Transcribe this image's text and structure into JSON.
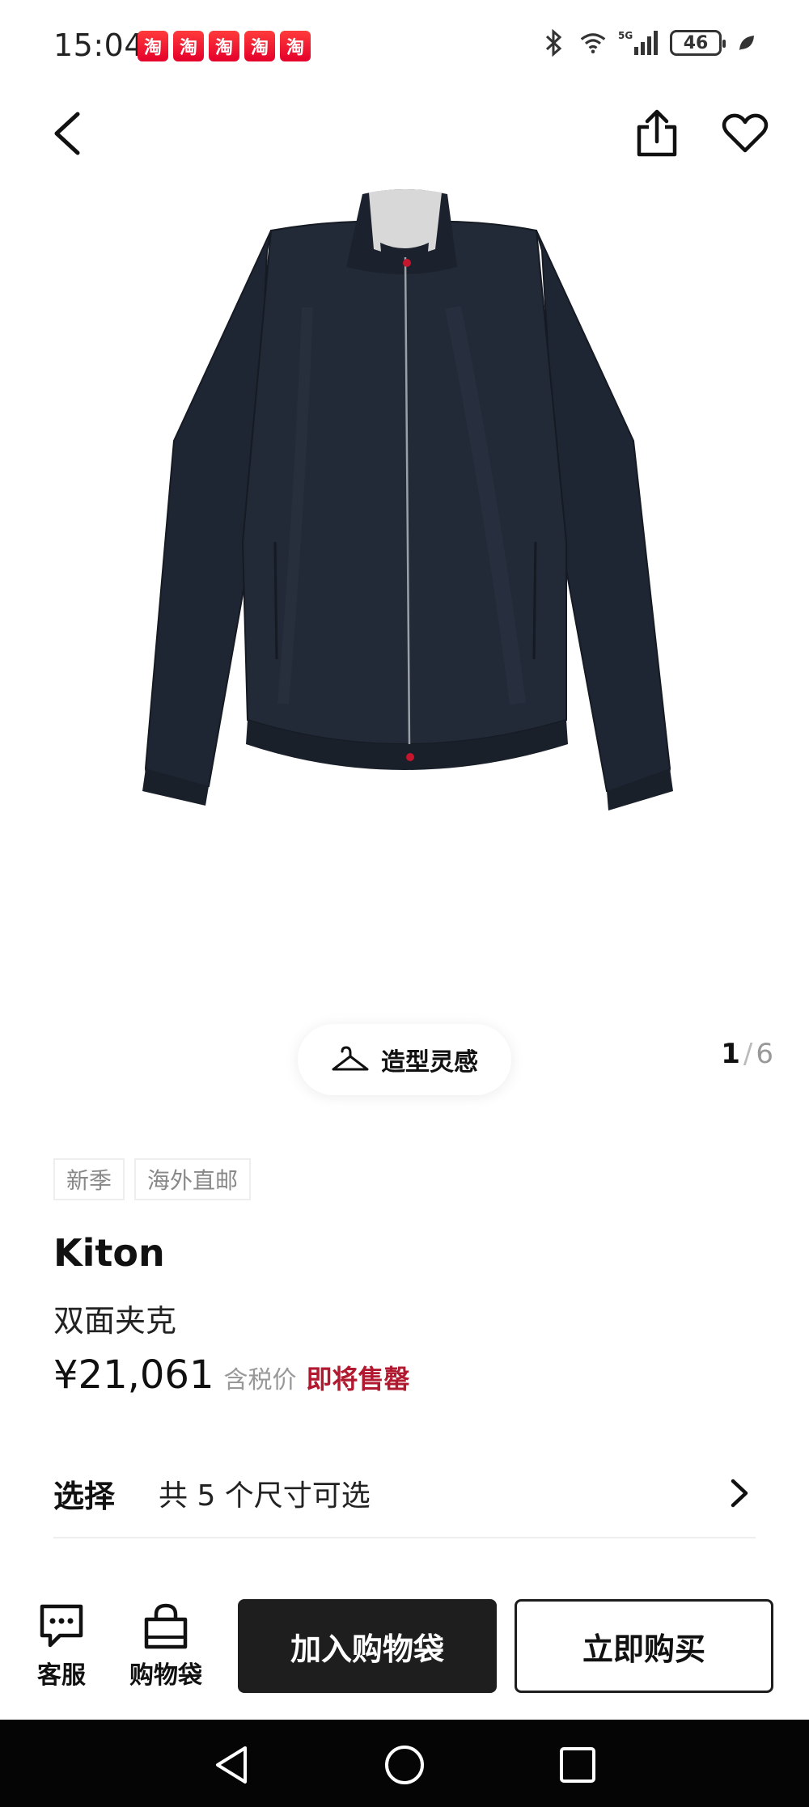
{
  "status_bar": {
    "time": "15:04",
    "app_badge_char": "淘",
    "network": "5G",
    "battery": "46"
  },
  "product": {
    "brand": "Kiton",
    "name": "双面夹克",
    "price": "¥21,061",
    "tax_note": "含税价",
    "stock_note": "即将售罄",
    "tags": [
      "新季",
      "海外直邮"
    ]
  },
  "gallery": {
    "styling_label": "造型灵感",
    "current_page": "1",
    "separator": "/",
    "total_pages": "6"
  },
  "selection": {
    "label": "选择",
    "value": "共 5 个尺寸可选"
  },
  "action_bar": {
    "service_label": "客服",
    "bag_label": "购物袋",
    "add_to_bag": "加入购物袋",
    "buy_now": "立即购买"
  },
  "colors": {
    "stock_red": "#b0192f",
    "dark_button": "#1e1e1e",
    "jacket_navy": "#1f2633"
  }
}
